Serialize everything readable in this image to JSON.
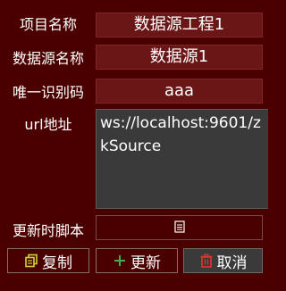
{
  "form": {
    "project_name": {
      "label": "项目名称",
      "value": "数据源工程1"
    },
    "source_name": {
      "label": "数据源名称",
      "value": "数据源1"
    },
    "unique_id": {
      "label": "唯一识别码",
      "value": "aaa"
    },
    "url": {
      "label": "url地址",
      "value": "ws://localhost:9601/zkSource"
    },
    "update_script": {
      "label": "更新时脚本",
      "icon": "script-document-icon"
    }
  },
  "buttons": {
    "copy": {
      "label": "复制",
      "icon": "copy-icon",
      "icon_color": "#c9d63a"
    },
    "update": {
      "label": "更新",
      "icon": "plus-icon",
      "icon_color": "#3fae49"
    },
    "cancel": {
      "label": "取消",
      "icon": "trash-icon",
      "icon_color": "#e0352b"
    }
  },
  "colors": {
    "background": "#4b0000",
    "field_background": "#6b1616",
    "textarea_background": "#3a3a3a"
  }
}
